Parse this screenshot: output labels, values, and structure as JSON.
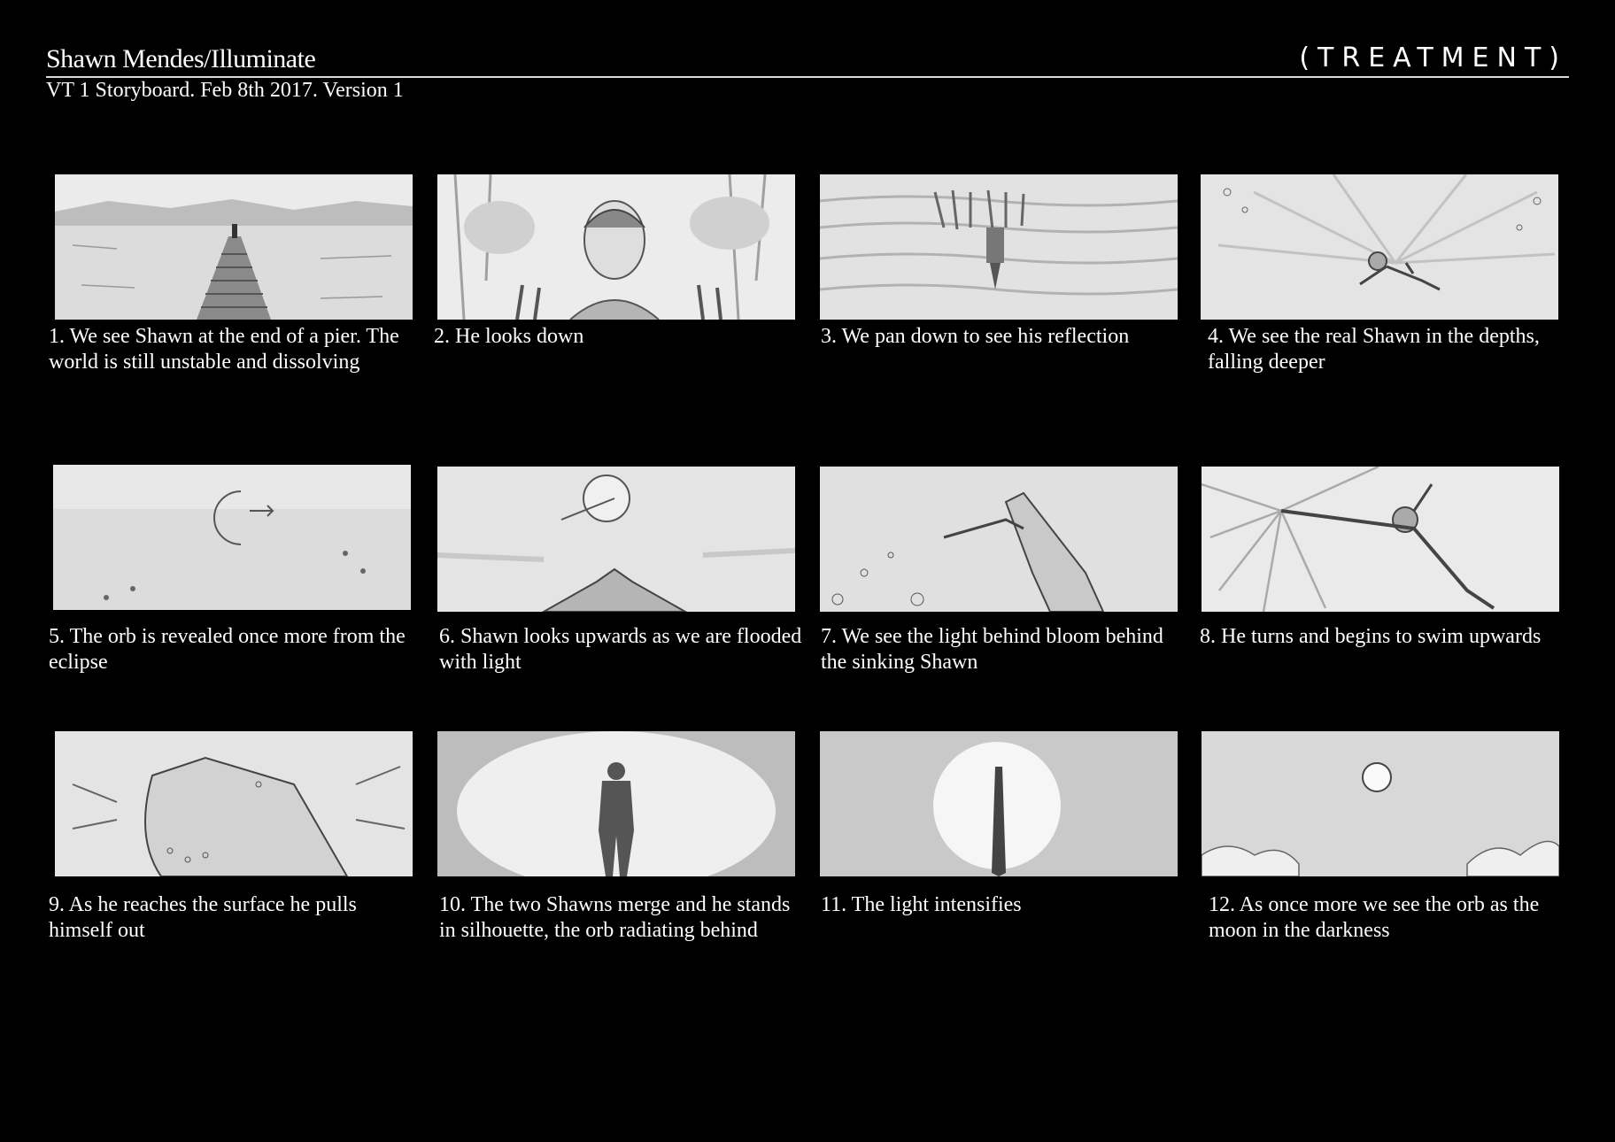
{
  "header": {
    "title": "Shawn Mendes/Illuminate",
    "subtitle": "VT 1 Storyboard. Feb 8th 2017. Version 1",
    "tag": "(TREATMENT)"
  },
  "frames": [
    {
      "caption": "1. We see Shawn at the end of a pier. The world is still unstable and dissolving"
    },
    {
      "caption": "2. He looks down"
    },
    {
      "caption": "3. We pan down to see his reflection"
    },
    {
      "caption": "4. We see the real Shawn in the depths, falling deeper"
    },
    {
      "caption": "5. The orb is revealed once more from the eclipse"
    },
    {
      "caption": "6. Shawn looks upwards as we are flooded with light"
    },
    {
      "caption": "7. We see the light behind bloom behind the sinking Shawn"
    },
    {
      "caption": "8. He turns and begins to swim upwards"
    },
    {
      "caption": "9. As he reaches the surface he pulls himself out"
    },
    {
      "caption": "10. The two Shawns merge and he stands in silhouette, the orb radiating behind"
    },
    {
      "caption": "11. The light intensifies"
    },
    {
      "caption": "12. As once more we see the orb as the moon in the darkness"
    }
  ],
  "colors": {
    "background": "#000000",
    "text": "#ffffff",
    "sketch_paper": "#ececec",
    "pencil": "#555555"
  }
}
